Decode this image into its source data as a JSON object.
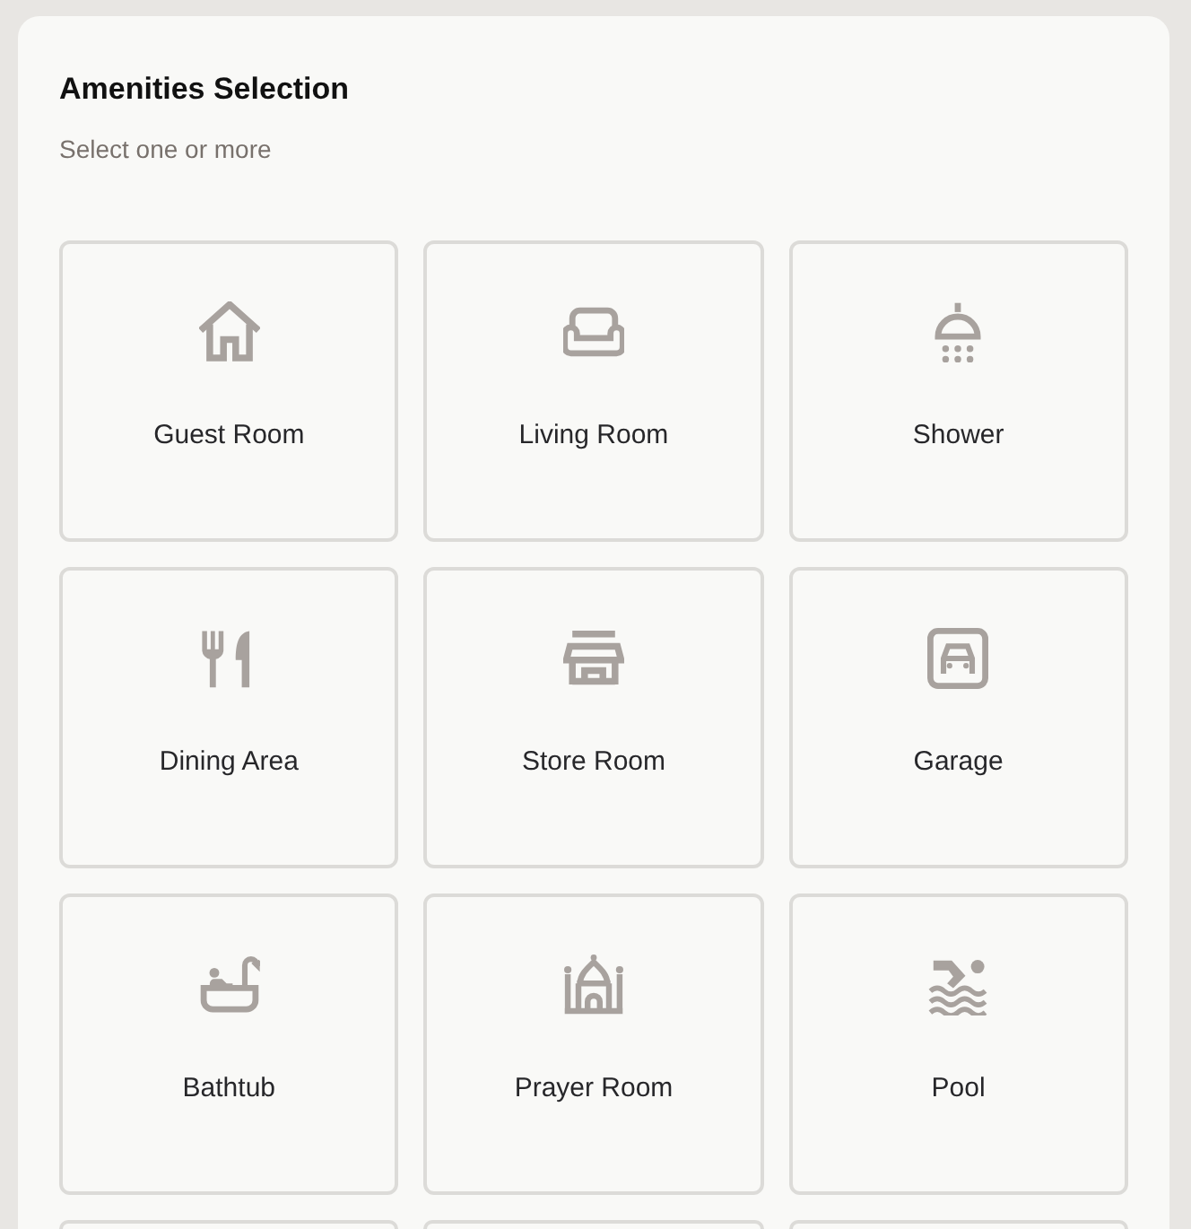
{
  "panel": {
    "title": "Amenities Selection",
    "subtitle": "Select one or more"
  },
  "amenities": [
    {
      "kind": "amenity",
      "label": "Guest Room",
      "selected": false
    },
    {
      "kind": "amenity",
      "label": "Living Room",
      "selected": false
    },
    {
      "kind": "amenity",
      "label": "Shower",
      "selected": false
    },
    {
      "kind": "amenity",
      "label": "Dining Area",
      "selected": false
    },
    {
      "kind": "amenity",
      "label": "Store Room",
      "selected": false
    },
    {
      "kind": "amenity",
      "label": "Garage",
      "selected": false
    },
    {
      "kind": "amenity",
      "label": "Bathtub",
      "selected": false
    },
    {
      "kind": "amenity",
      "label": "Prayer Room",
      "selected": false
    },
    {
      "kind": "amenity",
      "label": "Pool",
      "selected": false
    },
    {
      "kind": "cut_off",
      "selected": false
    },
    {
      "kind": "cut_off",
      "selected": false
    },
    {
      "kind": "cut_off",
      "selected": false
    }
  ]
}
